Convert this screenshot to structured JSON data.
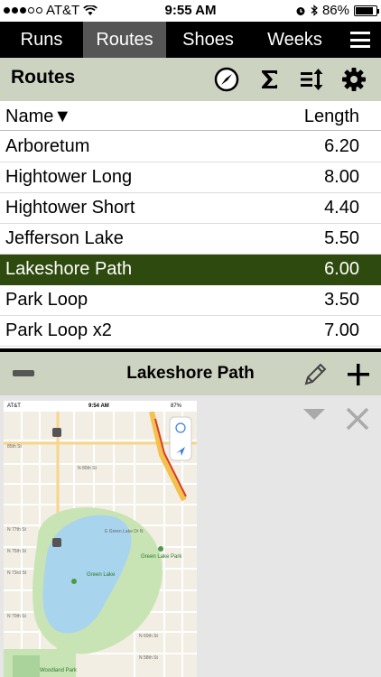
{
  "status_bar": {
    "carrier": "AT&T",
    "time": "9:55 AM",
    "battery": "86%",
    "battery_level": 0.86
  },
  "tabs": [
    {
      "label": "Runs",
      "active": false
    },
    {
      "label": "Routes",
      "active": true
    },
    {
      "label": "Shoes",
      "active": false
    },
    {
      "label": "Weeks",
      "active": false
    }
  ],
  "section": {
    "title": "Routes",
    "icons": [
      "compass-icon",
      "sigma-icon",
      "sort-icon",
      "gear-icon"
    ]
  },
  "columns": {
    "name": "Name▼",
    "length": "Length"
  },
  "routes": [
    {
      "name": "Arboretum",
      "length": "6.20",
      "selected": false
    },
    {
      "name": "Hightower Long",
      "length": "8.00",
      "selected": false
    },
    {
      "name": "Hightower Short",
      "length": "4.40",
      "selected": false
    },
    {
      "name": "Jefferson Lake",
      "length": "5.50",
      "selected": false
    },
    {
      "name": "Lakeshore Path",
      "length": "6.00",
      "selected": true
    },
    {
      "name": "Park Loop",
      "length": "3.50",
      "selected": false
    },
    {
      "name": "Park Loop x2",
      "length": "7.00",
      "selected": false
    }
  ],
  "detail": {
    "title": "Lakeshore Path"
  },
  "map_thumb": {
    "carrier": "AT&T",
    "time": "9:54 AM",
    "battery": "87%",
    "labels": {
      "street_85": "85th St",
      "street_80": "N 80th St",
      "street_77": "N 77th St",
      "street_75": "N 75th St",
      "street_73": "N 73rd St",
      "street_70": "N 70th St",
      "street_60": "N 60th St",
      "street_58": "N 58th St",
      "lake": "Green Lake",
      "lake_park": "Green Lake Park",
      "woodland": "Woodland Park",
      "lake_dr": "E Green Lake Dr N"
    }
  },
  "colors": {
    "accent_header": "#cdd3c1",
    "selected_row": "#2f4a0e",
    "tab_bar": "#000000",
    "tab_active": "#555555"
  }
}
